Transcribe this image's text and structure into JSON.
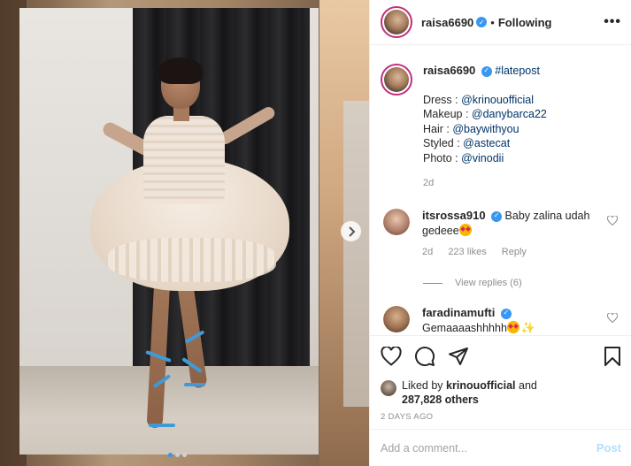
{
  "post": {
    "username": "raisa6690",
    "follow_state": "Following",
    "separator": "•",
    "more_label": "•••"
  },
  "caption": {
    "username": "raisa6690",
    "hashtag": "#latepost",
    "lines": [
      {
        "label": "Dress : ",
        "mention": "@krinouofficial"
      },
      {
        "label": "Makeup : ",
        "mention": "@danybarca22"
      },
      {
        "label": "Hair : ",
        "mention": "@baywithyou"
      },
      {
        "label": "Styled : ",
        "mention": "@astecat"
      },
      {
        "label": "Photo : ",
        "mention": "@vinodii"
      }
    ],
    "time": "2d"
  },
  "comments": [
    {
      "username": "itsrossa910",
      "text": "Baby zalina udah gedeee",
      "time": "2d",
      "likes": "223 likes",
      "reply": "Reply",
      "view_replies": "View replies (6)"
    },
    {
      "username": "faradinamufti",
      "text": "Gemaaaashhhhh"
    }
  ],
  "actions": {
    "liked_prefix": "Liked by ",
    "liked_user": "krinouofficial",
    "liked_and": " and",
    "liked_others": "287,828 others",
    "date": "2 DAYS AGO"
  },
  "composer": {
    "placeholder": "Add a comment...",
    "post_label": "Post"
  },
  "carousel": {
    "dot_count": 3,
    "active_index": 0
  },
  "colors": {
    "accent": "#3897f0",
    "link": "#003569",
    "muted": "#8e8e8e",
    "post_disabled": "#b2dffc"
  },
  "icons": [
    "verified-icon",
    "more-icon",
    "heart-icon",
    "comment-icon",
    "share-icon",
    "bookmark-icon",
    "chevron-right-icon"
  ]
}
